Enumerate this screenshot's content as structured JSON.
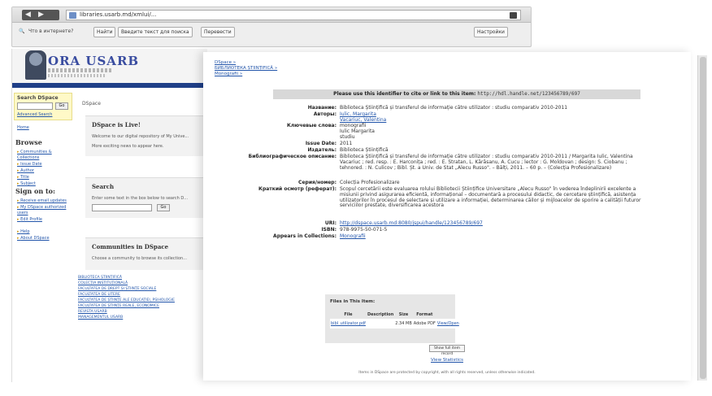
{
  "browser": {
    "url": "libraries.usarb.md/xmlui/...",
    "tb_search_label": "Введите текст для поиска",
    "tb_search_placeholder": "",
    "tb_btn_find": "Найти",
    "tb_btn_translate": "Перевести",
    "tb_text": "Что в интернете?",
    "tb_right": "Настройки"
  },
  "left_page": {
    "logo": "ORA USARB",
    "search_box": {
      "heading": "Search DSpace",
      "go": "Go",
      "advanced": "Advanced Search"
    },
    "home": "Home",
    "browse_heading": "Browse",
    "browse_links": [
      "Communities & Collections",
      "Issue Date",
      "Author",
      "Title",
      "Subject"
    ],
    "signon_heading": "Sign on to:",
    "signon_links": [
      "Receive email updates",
      "My DSpace authorized users",
      "Edit Profile"
    ],
    "help_links": [
      "Help",
      "About DSpace"
    ],
    "crumb": "DSpace",
    "panel1": {
      "heading": "DSpace is Live!",
      "line1": "Welcome to our digital repository of My Unive...",
      "line2": "More exciting news to appear here."
    },
    "panel2": {
      "heading": "Search",
      "line1": "Enter some text in the box below to search D...",
      "go": "Go"
    },
    "panel3": {
      "heading": "Communities in DSpace",
      "line1": "Choose a community to browse its collection..."
    },
    "communities": [
      "BIBLIOTECA ȘTIINȚIFICĂ",
      "COLECȚIA INSTITUȚIONALĂ",
      "FACULTATEA DE DREPT ȘI ȘTIINȚE SOCIALE",
      "FACULTATEA DE LITERE",
      "FACULTATEA DE ȘTIINȚE ALE EDUCAȚIEI, PSIHOLOGIE",
      "FACULTATEA DE ȘTIINȚE REALE, ECONOMICE",
      "REVISTA USARB",
      "MANAGEMENTUL USARB"
    ]
  },
  "item_page": {
    "crumbs": [
      "DSpace »",
      "БИБЛИОТЕКА ȘTIINȚIFICĂ »",
      "Monografii »"
    ],
    "cite_label": "Please use this identifier to cite or link to this item:",
    "cite_url": "http://hdl.handle.net/123456789/697",
    "metadata": [
      {
        "label": "Название:",
        "value": "Biblioteca Științifică și transferul de informație către utilizator : studiu comparativ 2010-2011"
      },
      {
        "label": "Авторы:",
        "value": "Iulic, Margarita\nVacariuc, Valentina",
        "link": true
      },
      {
        "label": "Ключевые слова:",
        "value": "monografii\nIulic Margarita\nstudiu"
      },
      {
        "label": "Issue Date:",
        "value": "2011"
      },
      {
        "label": "Издатель:",
        "value": "Biblioteca Științifică"
      },
      {
        "label": "Библиографическое описание:",
        "value": "Biblioteca Științifică și transferul de informație către utilizator : studiu comparativ 2010-2011 / Margarita Iulic, Valentina Vacariuc ; red. resp. : E. Harconița ; red. : E. Stratan, L. Kărăsanu, A. Cucu ; lector : G. Moldovan ; design: S. Ciobanu ; tehnored. : N. Culicov ; Bibl. Șt. a Univ. de Stat „Alecu Russo\". – Bălți, 2011. – 60 p. – (Colecția Profesionalizare)"
      },
      {
        "label": "Серия/номер:",
        "value": "Colecția Profesionalizare"
      },
      {
        "label": "Краткий осмотр (реферат):",
        "value": "Scopul cercetării este evaluarea rolului Bibliotecii Științifice Universitare „Alecu Russo\" în vederea îndeplinirii excelente a misiunii privind asigurarea eficientă, informațional – documentară a procesului didactic, de cercetare științifică, asistența utilizatorilor în procesul de selectare și utilizare a informației, determinarea căilor și mijloacelor de sporire a calității futuror serviciilor prestate, diversificarea acestora"
      },
      {
        "label": "URI:",
        "value": "http://dspace.usarb.md:8080/jspui/handle/123456789/697",
        "link": true
      },
      {
        "label": "ISBN:",
        "value": "978-9975-50-071-5"
      },
      {
        "label": "Appears in Collections:",
        "value": "Monografii",
        "link": true
      }
    ],
    "files": {
      "heading": "Files in This Item:",
      "columns": [
        "File",
        "Description",
        "Size",
        "Format",
        ""
      ],
      "row": [
        "bibl_utilizator.pdf",
        "",
        "2.34 MB",
        "Adobe PDF",
        "View/Open"
      ]
    },
    "full_record": "Show full item record",
    "stats": "View Statistics",
    "footer": "Items in DSpace are protected by copyright, with all rights reserved, unless otherwise indicated."
  }
}
